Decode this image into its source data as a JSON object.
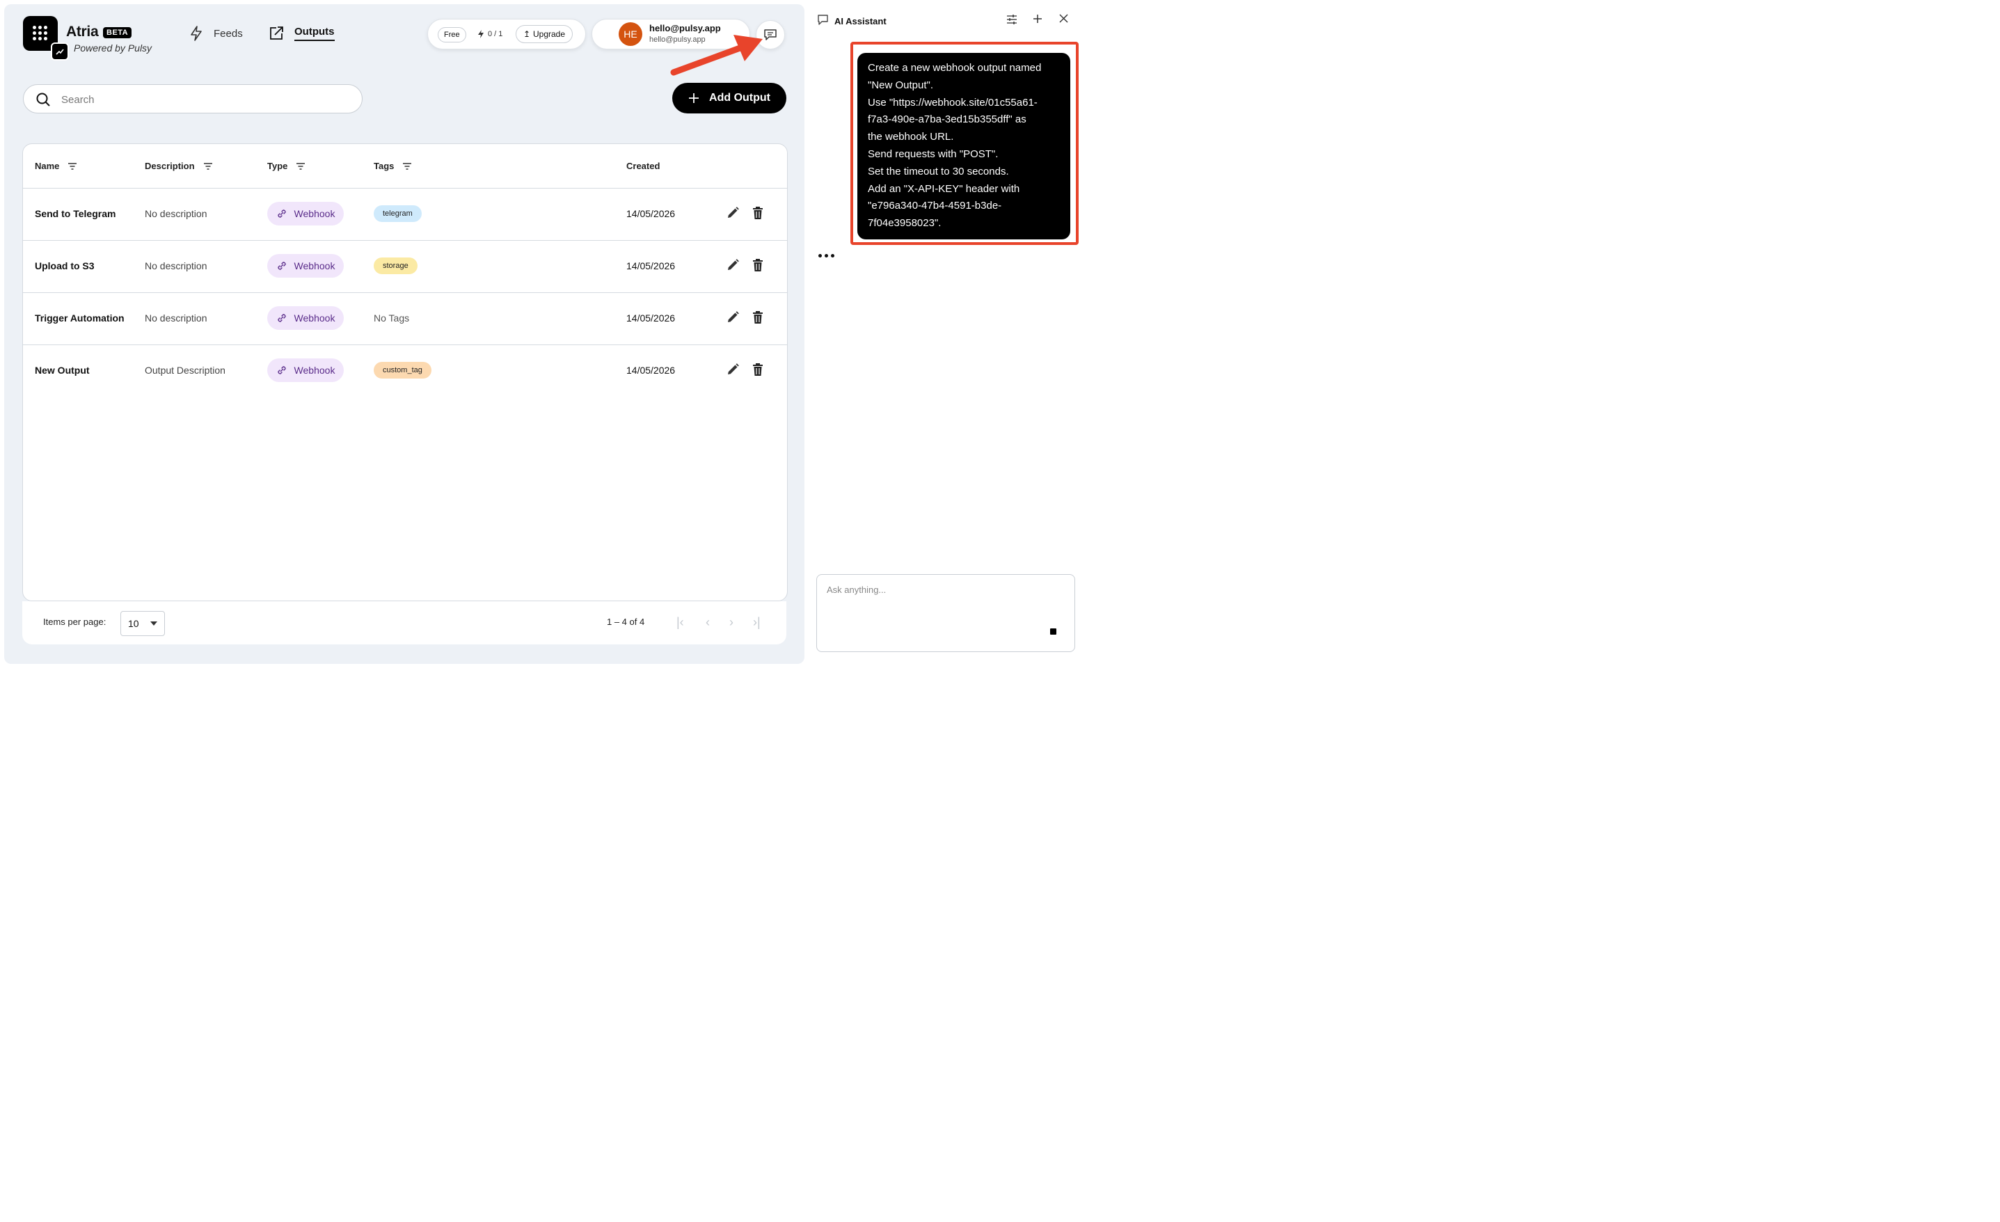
{
  "brand": {
    "name": "Atria",
    "badge": "BETA",
    "subtitle": "Powered by Pulsy"
  },
  "nav": [
    {
      "label": "Feeds",
      "icon": "lightning-icon",
      "active": false
    },
    {
      "label": "Outputs",
      "icon": "share-square-icon",
      "active": true
    }
  ],
  "plan": {
    "free": "Free",
    "credits": "0 / 1",
    "upgrade": "Upgrade"
  },
  "user": {
    "initials": "HE",
    "name": "hello@pulsy.app",
    "email": "hello@pulsy.app",
    "avatar_color": "#d4530f"
  },
  "search": {
    "placeholder": "Search",
    "value": ""
  },
  "actions": {
    "add_output": "Add Output"
  },
  "table": {
    "columns": [
      "Name",
      "Description",
      "Type",
      "Tags",
      "Created"
    ],
    "rows": [
      {
        "name": "Send to Telegram",
        "description": "No description",
        "type": "Webhook",
        "tag": "telegram",
        "tag_color": "#cfeafc",
        "created": "14/05/2026"
      },
      {
        "name": "Upload to S3",
        "description": "No description",
        "type": "Webhook",
        "tag": "storage",
        "tag_color": "#fbeaa4",
        "created": "14/05/2026"
      },
      {
        "name": "Trigger Automation",
        "description": "No description",
        "type": "Webhook",
        "tag": "",
        "no_tags": "No Tags",
        "created": "14/05/2026"
      },
      {
        "name": "New Output",
        "description": "Output Description",
        "type": "Webhook",
        "tag": "custom_tag",
        "tag_color": "#fcd9b0",
        "created": "14/05/2026"
      }
    ]
  },
  "pagination": {
    "label": "Items per page:",
    "per_page": "10",
    "range": "1 – 4 of 4"
  },
  "assistant": {
    "title": "AI Assistant",
    "message_lines": [
      "Create a new webhook output named",
      "\"New Output\".",
      "Use \"https://webhook.site/01c55a61-",
      "f7a3-490e-a7ba-3ed15b355dff\" as",
      "the webhook URL.",
      "Send requests with \"POST\".",
      "Set the timeout to 30 seconds.",
      "Add an \"X-API-KEY\" header with",
      "\"e796a340-47b4-4591-b3de-",
      "7f04e3958023\"."
    ],
    "input_placeholder": "Ask anything..."
  },
  "colors": {
    "annotation_red": "#e8442b",
    "chip_purple": "#f1e6fb",
    "chip_text": "#5a2c8a"
  }
}
